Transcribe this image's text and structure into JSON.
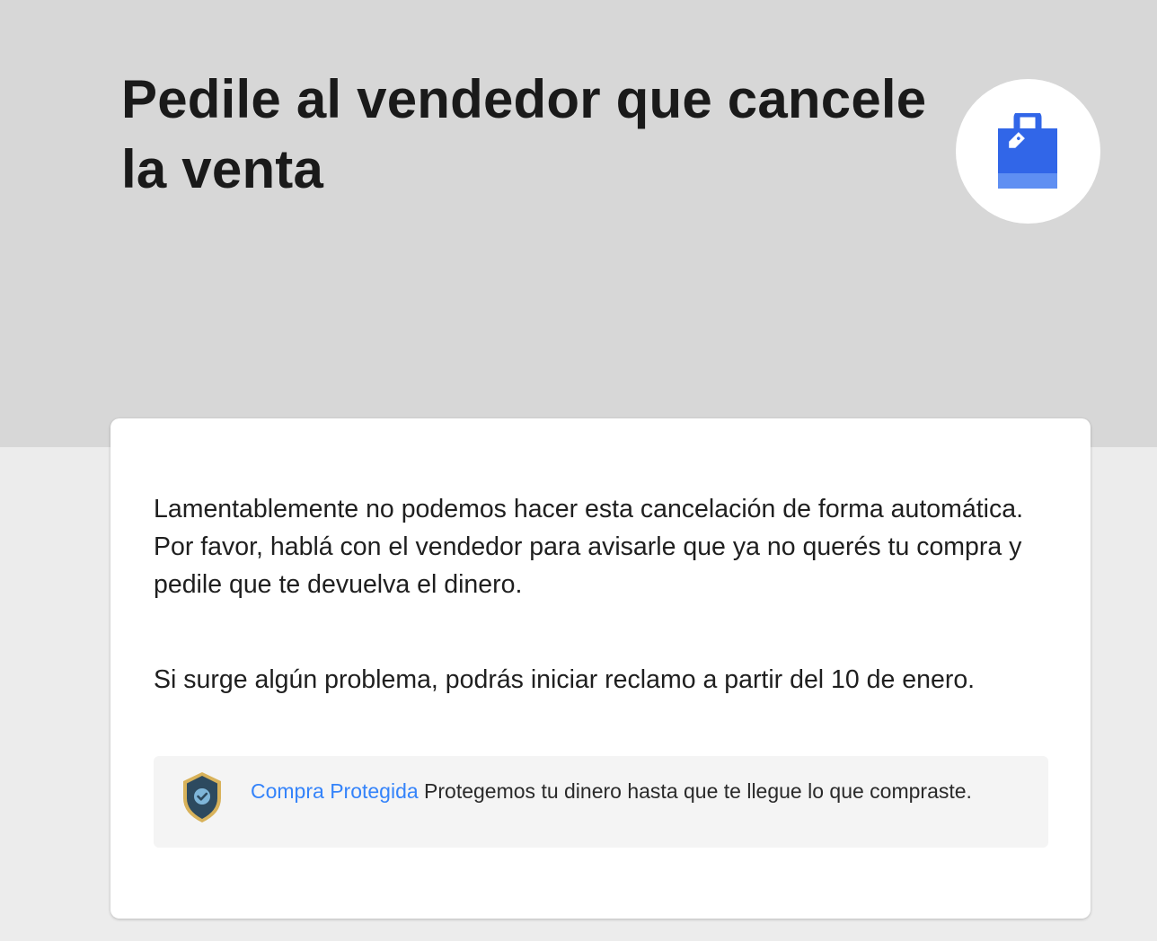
{
  "header": {
    "title": "Pedile al vendedor que cancele la venta",
    "icon": "shopping-bag-icon",
    "accent_color": "#3166e8"
  },
  "card": {
    "paragraph_1": "Lamentablemente no podemos hacer esta cancelación de forma automática. Por favor, hablá con el vendedor para avisarle que ya no querés tu compra y pedile que te devuelva el dinero.",
    "paragraph_2": "Si surge algún problema, podrás iniciar reclamo a partir del 10 de enero.",
    "protection": {
      "icon": "shield-check-icon",
      "link_label": "Compra Protegida",
      "description": "Protegemos tu dinero hasta que te llegue lo que compraste.",
      "link_color": "#3483fa"
    }
  }
}
